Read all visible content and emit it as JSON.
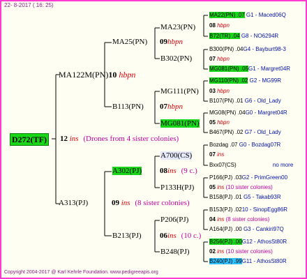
{
  "header": "22-  8-2017  ( 16: 25)",
  "footer": "Copyright 2004-2017 @ Karl Kehrle Foundation.   www.pedigreeapis.org",
  "root": {
    "label": "D272(TF)",
    "num": "12",
    "ins": "ins",
    "note": "(Drones from 4 sister colonies)"
  },
  "gen1": [
    {
      "label": "MA122M(PN)",
      "num": "10",
      "tag": "hbpn"
    },
    {
      "label": "A313(PJ)",
      "num": "09",
      "ins": "ins",
      "note": "(8 sister colonies)"
    }
  ],
  "gen2": [
    {
      "label": "MA25(PN)",
      "num": "09",
      "tag": "hbpn"
    },
    {
      "label": "B113(PN)",
      "num": "07",
      "tag": "hbpn"
    },
    {
      "label": "A302(PJ)",
      "num": "08",
      "ins": "ins",
      "note": "(9 c.)"
    },
    {
      "label": "B213(PJ)",
      "num": "06",
      "ins": "ins",
      "note": "(10 c.)"
    }
  ],
  "gen3": [
    {
      "label": "MA23(PN)",
      "num": "08",
      "tag": "hbpn"
    },
    {
      "label": "B302(PN)",
      "num": "07",
      "tag": "hbpn"
    },
    {
      "label": "MG111(PN)",
      "num": "07",
      "tag": "hbpn"
    },
    {
      "label": "MG081(PN)",
      "num": "05",
      "tag": "hbpn"
    },
    {
      "label": "A700(CS)",
      "num": "07",
      "ins": "ins"
    },
    {
      "label": "P133H(PJ)",
      "num": "",
      "ins": ""
    },
    {
      "label": "P206(PJ)",
      "num": "04",
      "ins": "ins"
    },
    {
      "label": "B248(PJ)",
      "num": "02",
      "ins": "ins"
    }
  ],
  "gen4": [
    {
      "a": "MA22(PN) .07",
      "b": "G1 - Maced06Q"
    },
    {
      "a": "08",
      "b": "hbpn"
    },
    {
      "a": "B72(TR) .04",
      "b": "G8 - NO6294R"
    },
    {
      "a": "B300(PN) .04",
      "b": "G4 - Bayburt98-3"
    },
    {
      "a": "07",
      "b": "hbpn"
    },
    {
      "a": "MG081(PN) .05",
      "b": "G1 - Margret04R"
    },
    {
      "a": "MG110(PN) .02",
      "b": "G2 - MG99R"
    },
    {
      "a": "03",
      "b": "hbpn"
    },
    {
      "a": "B107(PN) .01",
      "b": "G6 - Old_Lady"
    },
    {
      "a": "MG08(PN) .04",
      "b": "G0 - Margret04R"
    },
    {
      "a": "05",
      "b": "hbpn"
    },
    {
      "a": "B467(PN) .02",
      "b": "G7 - Old_Lady"
    },
    {
      "a": "Bozdag .07",
      "b": "G0 - Bozdag07R"
    },
    {
      "a": "07",
      "b": "ins"
    },
    {
      "a": "Bxx07(CS)",
      "b": "no more"
    },
    {
      "a": "P166(PJ) .03",
      "b": "G2 - PrimGreen00"
    },
    {
      "a": "05",
      "b": "ins",
      "c": "(10 sister colonies)"
    },
    {
      "a": "B158(PJ) .01",
      "b": "G5 - Takab93R"
    },
    {
      "a": "B153(PJ) .02",
      "b": "10 - SinopEgg86R"
    },
    {
      "a": "04",
      "b": "ins",
      "c": "(8 sister colonies)"
    },
    {
      "a": "A164(PJ) .00",
      "b": "G3 - Cankiri97Q"
    },
    {
      "a": "B256(PJ) .00",
      "b": "G12 - AthosSt80R"
    },
    {
      "a": "02",
      "b": "ins",
      "c": "(10 sister colonies)"
    },
    {
      "a": "B240(PJ) .99",
      "b": "G11 - AthosSt80R"
    }
  ]
}
